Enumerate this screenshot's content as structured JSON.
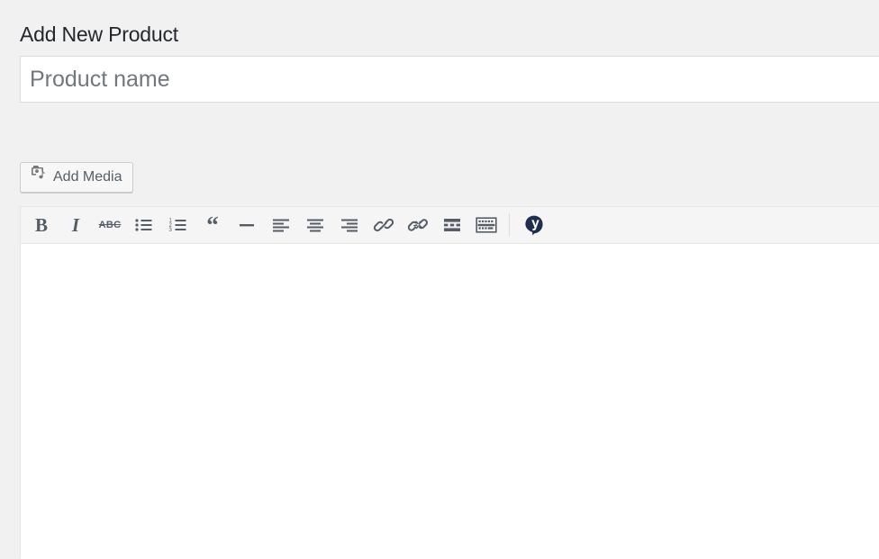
{
  "page": {
    "title": "Add New Product",
    "background_color": "#f1f1f1",
    "title_color": "#23282d"
  },
  "title_field": {
    "name": "product-title-input",
    "value": "",
    "placeholder": "Product name",
    "placeholder_color": "#72777c"
  },
  "media_bar": {
    "add_media": {
      "label": "Add Media",
      "icon": "add-media-icon"
    }
  },
  "editor": {
    "icon_color": "#555d66",
    "toolbar_background": "#f5f5f5",
    "toolbar": [
      {
        "name": "bold",
        "label": "B",
        "icon": "bold-icon",
        "kind": "text-bold"
      },
      {
        "name": "italic",
        "label": "I",
        "icon": "italic-icon",
        "kind": "text-italic"
      },
      {
        "name": "strikethrough",
        "label": "ABC",
        "icon": "strikethrough-icon",
        "kind": "text-strike"
      },
      {
        "name": "bulleted-list",
        "label": "",
        "icon": "bulleted-list-icon",
        "kind": "svg-ul"
      },
      {
        "name": "numbered-list",
        "label": "",
        "icon": "numbered-list-icon",
        "kind": "svg-ol"
      },
      {
        "name": "blockquote",
        "label": "“",
        "icon": "blockquote-icon",
        "kind": "text-quote"
      },
      {
        "name": "horizontal-rule",
        "label": "",
        "icon": "horizontal-rule-icon",
        "kind": "svg-hr"
      },
      {
        "name": "align-left",
        "label": "",
        "icon": "align-left-icon",
        "kind": "svg-align-left"
      },
      {
        "name": "align-center",
        "label": "",
        "icon": "align-center-icon",
        "kind": "svg-align-center"
      },
      {
        "name": "align-right",
        "label": "",
        "icon": "align-right-icon",
        "kind": "svg-align-right"
      },
      {
        "name": "insert-link",
        "label": "",
        "icon": "link-icon",
        "kind": "svg-link"
      },
      {
        "name": "remove-link",
        "label": "",
        "icon": "unlink-icon",
        "kind": "svg-unlink"
      },
      {
        "name": "insert-read-more",
        "label": "",
        "icon": "read-more-icon",
        "kind": "svg-more"
      },
      {
        "name": "toggle-toolbar",
        "label": "",
        "icon": "toolbar-toggle-icon",
        "kind": "svg-kitchen-sink"
      },
      {
        "name": "separator",
        "label": "",
        "icon": "separator",
        "kind": "separator"
      },
      {
        "name": "seo-analysis",
        "label": "",
        "icon": "yoast-seo-icon",
        "kind": "svg-yoast"
      }
    ],
    "content": "",
    "background": "#ffffff"
  }
}
